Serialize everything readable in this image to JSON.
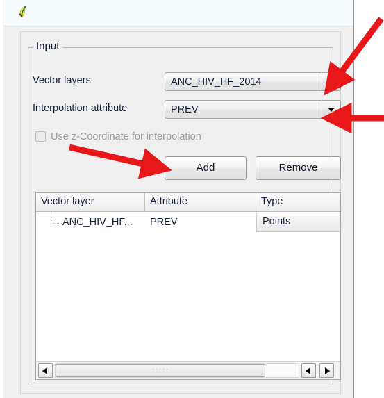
{
  "window": {
    "app_icon": "qgis-leaf-icon",
    "titlebar_color": "#f5fbfe"
  },
  "group": {
    "title": "Input"
  },
  "form": {
    "vector_layers_label": "Vector layers",
    "vector_layers_value": "ANC_HIV_HF_2014",
    "interpolation_attribute_label": "Interpolation attribute",
    "interpolation_attribute_value": "PREV",
    "z_coordinate_checkbox_label": "Use z-Coordinate for interpolation",
    "z_coordinate_checked": false,
    "z_coordinate_enabled": false
  },
  "buttons": {
    "add_label": "Add",
    "remove_label": "Remove"
  },
  "table": {
    "columns": [
      "Vector layer",
      "Attribute",
      "Type"
    ],
    "rows": [
      {
        "vector_layer": "ANC_HIV_HF...",
        "attribute": "PREV",
        "type": "Points"
      }
    ]
  },
  "scrollbar": {
    "left_arrow": "triangle-left-icon",
    "left_arrow_2": "triangle-left-icon",
    "right_arrow": "triangle-right-icon",
    "grip": "scrollbar-grip"
  },
  "annotations": {
    "accent_color": "#e8171a",
    "arrows": [
      {
        "name": "arrow-to-vector-layers-dropdown",
        "points_to": "vector layers dropdown arrow"
      },
      {
        "name": "arrow-to-interpolation-attribute-dropdown",
        "points_to": "interpolation attribute dropdown arrow"
      },
      {
        "name": "arrow-to-add-button",
        "points_to": "Add button"
      }
    ]
  },
  "icons": {
    "combo_arrow": "chevron-down-icon"
  }
}
